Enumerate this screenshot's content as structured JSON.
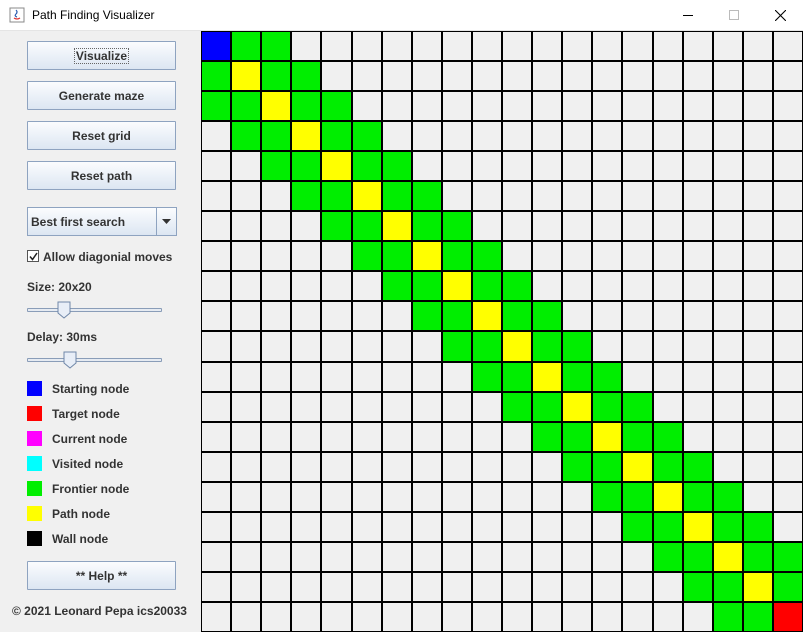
{
  "window": {
    "title": "Path Finding Visualizer",
    "controls": [
      "minimize-icon",
      "maximize-icon",
      "close-icon"
    ]
  },
  "sidebar": {
    "buttons": {
      "visualize": "Visualize",
      "generate_maze": "Generate maze",
      "reset_grid": "Reset grid",
      "reset_path": "Reset path",
      "help": "** Help **"
    },
    "algorithm": {
      "selected": "Best first search"
    },
    "allow_diagonal": {
      "label": "Allow diagonial moves",
      "checked": true
    },
    "size": {
      "label": "Size: 20x20",
      "value_fraction": 0.25
    },
    "delay": {
      "label": "Delay: 30ms",
      "value_fraction": 0.3
    },
    "legend": [
      {
        "label": "Starting node",
        "color": "#0000ff"
      },
      {
        "label": "Target node",
        "color": "#ff0000"
      },
      {
        "label": "Current node",
        "color": "#ff00ff"
      },
      {
        "label": "Visited node",
        "color": "#00ffff"
      },
      {
        "label": "Frontier node",
        "color": "#00ee00"
      },
      {
        "label": "Path node",
        "color": "#ffff00"
      },
      {
        "label": "Wall node",
        "color": "#000000"
      }
    ],
    "copyright": "© 2021 Leonard Pepa ics20033"
  },
  "grid": {
    "rows": 20,
    "cols": 20,
    "colors": {
      "empty": "#f0f0f0",
      "start": "#0000ff",
      "target": "#ff0000",
      "frontier": "#00ee00",
      "path": "#ffff00"
    },
    "cells": [
      "SFF.................",
      "FPFF................",
      "FFPFF...............",
      ".FFPFF..............",
      "..FFPFF.............",
      "...FFPFF............",
      "....FFPFF...........",
      ".....FFPFF..........",
      "......FFPFF.........",
      ".......FFPFF........",
      "........FFPFF.......",
      ".........FFPFF......",
      "..........FFPFF.....",
      "...........FFPFF....",
      "............FFPFF...",
      ".............FFPFF..",
      "..............FFPFF.",
      "...............FFPFF",
      "................FFPF",
      ".................FFT"
    ]
  }
}
